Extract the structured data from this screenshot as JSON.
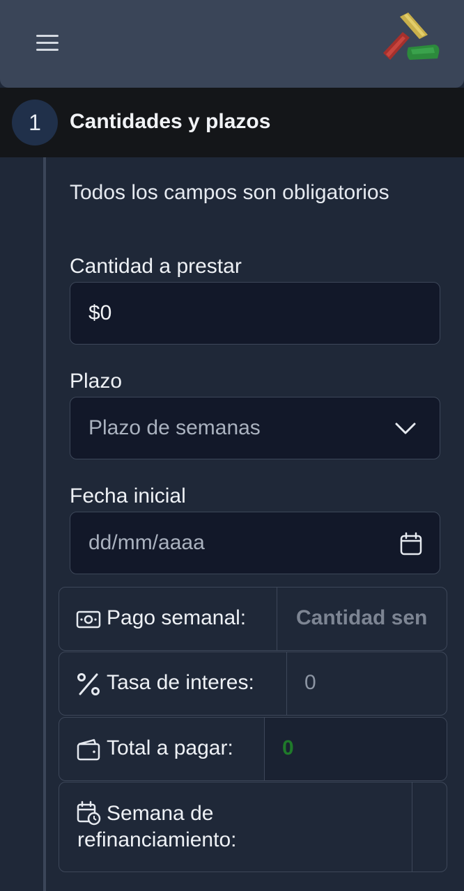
{
  "header": {
    "menu_icon": "hamburger-menu-icon",
    "logo_icon": "brand-logo-icon"
  },
  "step": {
    "number": "1",
    "title": "Cantidades y plazos"
  },
  "form": {
    "notice": "Todos los campos son obligatorios",
    "amount": {
      "label": "Cantidad a prestar",
      "value": "$0"
    },
    "term": {
      "label": "Plazo",
      "placeholder": "Plazo de semanas"
    },
    "start_date": {
      "label": "Fecha inicial",
      "placeholder": "dd/mm/aaaa"
    }
  },
  "summary": {
    "weekly_payment": {
      "label": "Pago semanal:",
      "value": "Cantidad sen",
      "icon": "money-bill-icon"
    },
    "interest_rate": {
      "label": "Tasa de interes:",
      "value": "0",
      "icon": "percent-icon"
    },
    "total": {
      "label": "Total a pagar:",
      "value": "0",
      "icon": "wallet-icon",
      "color": "#1f7a2a"
    },
    "refinance_week": {
      "label_line1": "Semana de",
      "label_line2": "refinanciamiento:",
      "value": "",
      "icon": "calendar-clock-icon"
    }
  },
  "colors": {
    "background": "#1f2838",
    "topbar": "#3a4558",
    "step_header": "#141619",
    "input_bg": "#121829",
    "total_value": "#1f7a2a"
  }
}
